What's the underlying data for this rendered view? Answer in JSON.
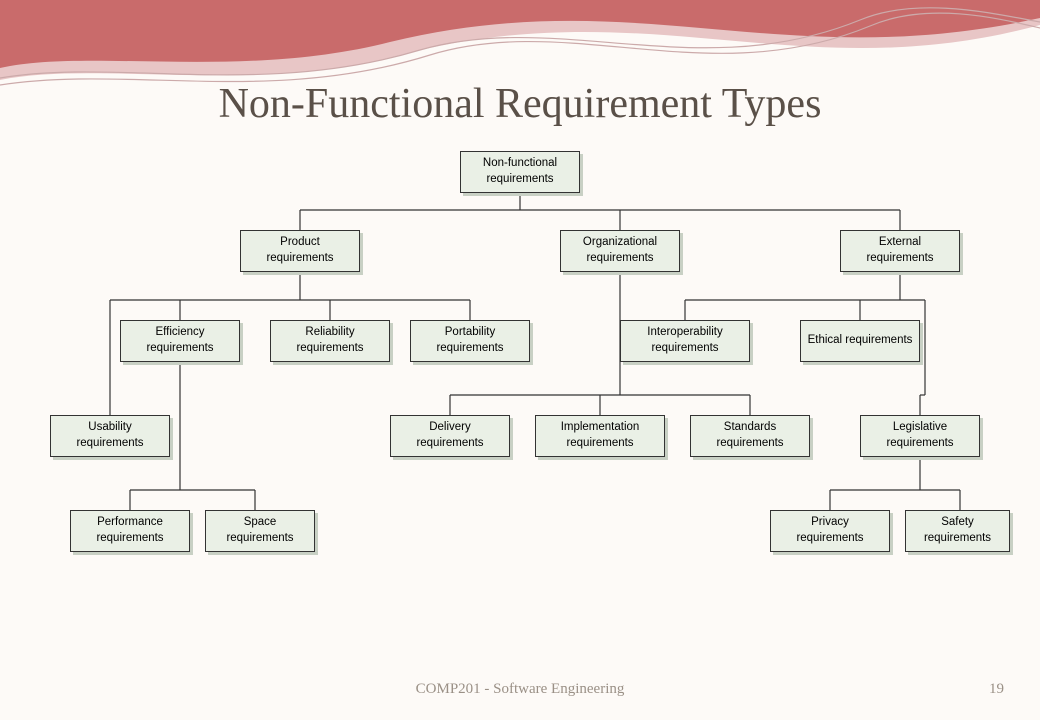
{
  "title": "Non-Functional Requirement Types",
  "footer": "COMP201 - Software Engineering",
  "page_number": "19",
  "chart_data": {
    "type": "tree",
    "nodes": {
      "root": "Non-functional\nrequirements",
      "product": "Product\nrequirements",
      "organizational": "Organizational\nrequirements",
      "external": "External\nrequirements",
      "efficiency": "Efficiency\nrequirements",
      "reliability": "Reliability\nrequirements",
      "portability": "Portability\nrequirements",
      "interoperability": "Interoperability\nrequirements",
      "ethical": "Ethical\nrequirements",
      "usability": "Usability\nrequirements",
      "delivery": "Delivery\nrequirements",
      "implementation": "Implementation\nrequirements",
      "standards": "Standards\nrequirements",
      "legislative": "Legislative\nrequirements",
      "performance": "Performance\nrequirements",
      "space": "Space\nrequirements",
      "privacy": "Privacy\nrequirements",
      "safety": "Safety\nrequirements"
    },
    "edges": [
      [
        "root",
        "product"
      ],
      [
        "root",
        "organizational"
      ],
      [
        "root",
        "external"
      ],
      [
        "product",
        "efficiency"
      ],
      [
        "product",
        "reliability"
      ],
      [
        "product",
        "portability"
      ],
      [
        "product",
        "usability"
      ],
      [
        "efficiency",
        "performance"
      ],
      [
        "efficiency",
        "space"
      ],
      [
        "organizational",
        "delivery"
      ],
      [
        "organizational",
        "implementation"
      ],
      [
        "organizational",
        "standards"
      ],
      [
        "external",
        "interoperability"
      ],
      [
        "external",
        "ethical"
      ],
      [
        "external",
        "legislative"
      ],
      [
        "legislative",
        "privacy"
      ],
      [
        "legislative",
        "safety"
      ]
    ]
  }
}
